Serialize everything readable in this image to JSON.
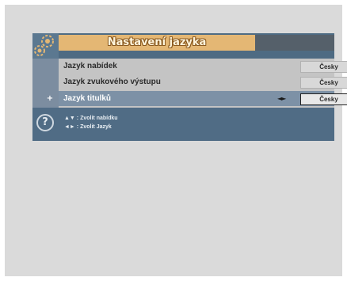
{
  "menu": {
    "title": "Nastavení jazyka",
    "selected_marker": "+",
    "items": [
      {
        "label": "Jazyk nabídek",
        "value": "Česky",
        "selected": false
      },
      {
        "label": "Jazyk zvukového výstupu",
        "value": "Česky",
        "selected": false
      },
      {
        "label": "Jazyk titulků",
        "value": "Česky",
        "selected": true,
        "arrows": "◄►"
      }
    ]
  },
  "help": {
    "icon_glyph": "?",
    "lines": [
      "▲▼ : Zvolit nabídku",
      "◄► : Zvolit Jazyk"
    ]
  },
  "colors": {
    "page_background": "#dadada",
    "osd_background": "#4e6b83",
    "title_bar": "#e4b774",
    "list_background": "#c4c4c4",
    "selected_row": "#7d91a6"
  },
  "icons": {
    "corner": "settings-gear-icon",
    "help": "help-question-icon",
    "selection": "pointer-icon"
  }
}
